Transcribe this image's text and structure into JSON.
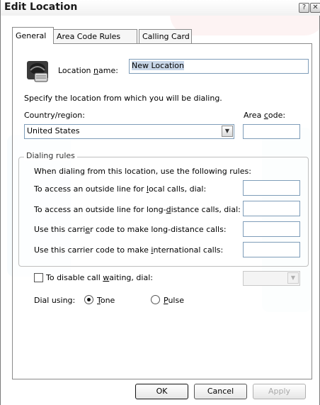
{
  "window": {
    "title": "Edit Location",
    "help_glyph": "?",
    "close_glyph": "✕"
  },
  "tabs": [
    {
      "label": "General",
      "active": true
    },
    {
      "label": "Area Code Rules",
      "active": false
    },
    {
      "label": "Calling Card",
      "active": false
    }
  ],
  "general": {
    "location_name_label_pre": "Location ",
    "location_name_label_key": "n",
    "location_name_label_post": "ame:",
    "location_name_value": "New Location",
    "specify_text": "Specify the location from which you will be dialing.",
    "country_label": "Country/region:",
    "country_value": "United States",
    "area_code_label_pre": "Area ",
    "area_code_label_key": "c",
    "area_code_label_post": "ode:",
    "area_code_value": ""
  },
  "dialing_rules": {
    "group_title": "Dialing rules",
    "intro": "When dialing from this location, use the following rules:",
    "local_pre": "To access an outside line for ",
    "local_key": "l",
    "local_post": "ocal calls, dial:",
    "long_pre": "To access an outside line for long-",
    "long_key": "d",
    "long_post": "istance calls, dial:",
    "carrier_long_pre": "Use this carri",
    "carrier_long_key": "e",
    "carrier_long_post": "r code to make long-distance calls:",
    "carrier_intl_pre": "Use this carrier code to make ",
    "carrier_intl_key": "i",
    "carrier_intl_post": "nternational calls:"
  },
  "call_waiting": {
    "label_pre": "To disable call ",
    "label_key": "w",
    "label_post": "aiting, dial:",
    "checked": false
  },
  "dial_using": {
    "label": "Dial using:",
    "tone_key": "T",
    "tone_post": "one",
    "pulse_key": "P",
    "pulse_post": "ulse",
    "selected": "Tone"
  },
  "buttons": {
    "ok": "OK",
    "cancel": "Cancel",
    "apply": "Apply"
  },
  "icons": {
    "location": "location-phone-icon",
    "dropdown": "chevron-down-icon"
  },
  "colors": {
    "field_border": "#7f9db9",
    "selection": "#c8d6e8"
  }
}
